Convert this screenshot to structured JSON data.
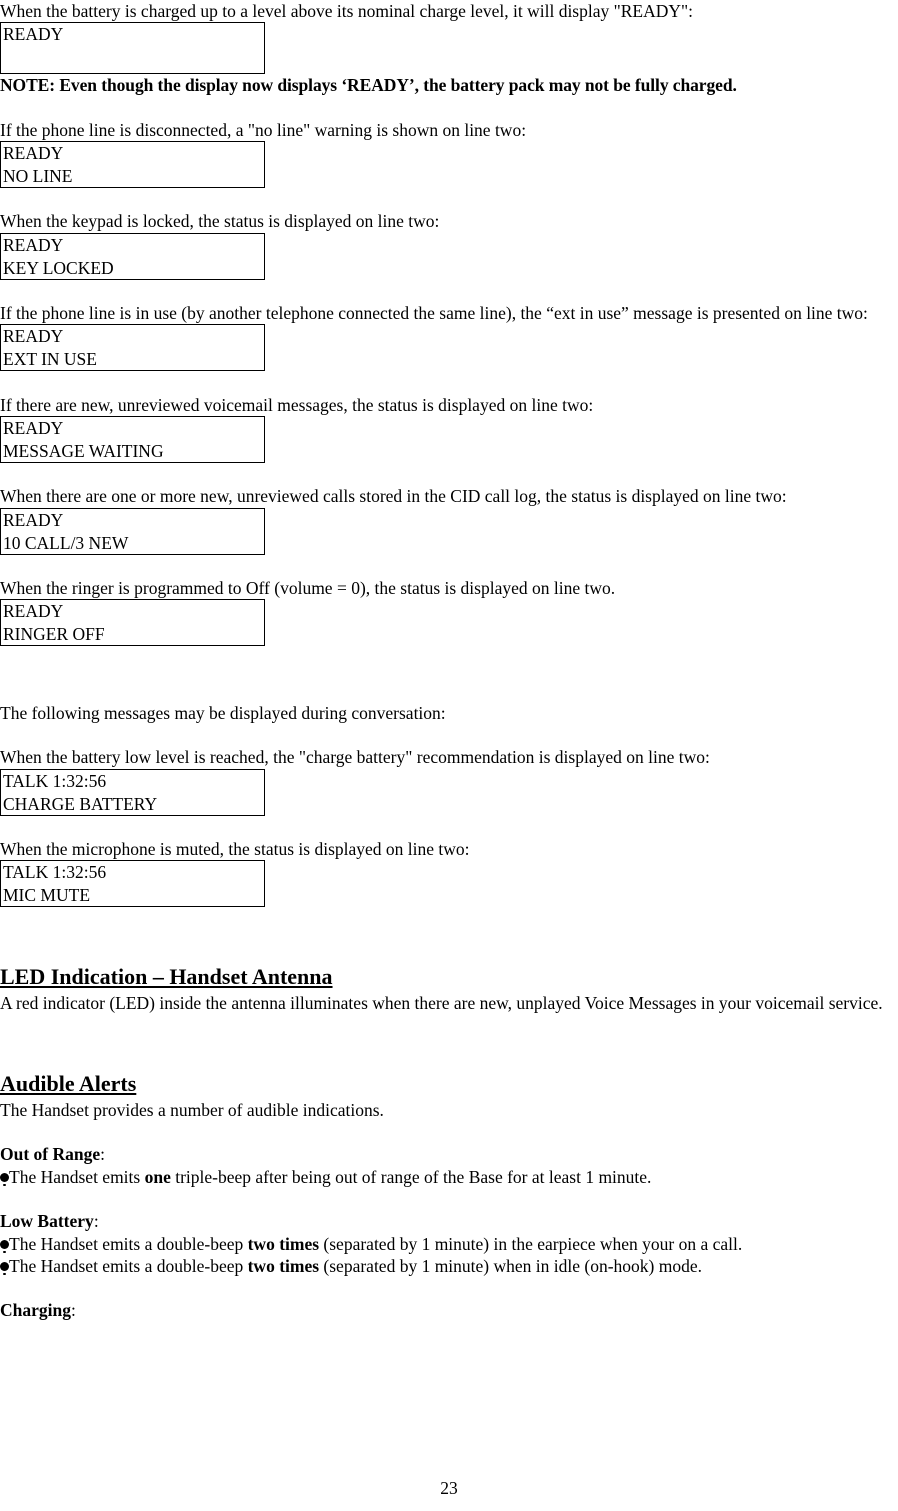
{
  "document": {
    "page_number": "23",
    "intro_paragraph": "When the battery is charged up to a level above its nominal charge level, it will display \"READY\":",
    "note": "NOTE:  Even though the display now displays ‘READY’, the battery pack may not be fully charged.",
    "sections": [
      {
        "paragraph": "If the phone line is disconnected, a \"no line\" warning is shown on line two:",
        "display_line1": "READY",
        "display_line2": "NO LINE"
      },
      {
        "paragraph": "When the keypad is locked, the status is displayed on line two:",
        "display_line1": "READY",
        "display_line2": "KEY LOCKED"
      },
      {
        "paragraph": "If the phone line is in use (by another telephone connected the same line), the “ext in use” message is presented on line two:",
        "display_line1": "READY",
        "display_line2": "EXT IN USE"
      },
      {
        "paragraph": "If there are new, unreviewed voicemail messages, the status is displayed on line two:",
        "display_line1": "READY",
        "display_line2": "MESSAGE WAITING"
      },
      {
        "paragraph": "When there are one or more new, unreviewed calls stored in the CID call log, the status is displayed on line two:",
        "display_line1": "READY",
        "display_line2": "10 CALL/3 NEW"
      },
      {
        "paragraph": "When the ringer is programmed to Off (volume = 0), the status is displayed on line two.",
        "display_line1": "READY",
        "display_line2": "RINGER OFF"
      }
    ],
    "first_display": {
      "line1": "READY",
      "line2": ""
    },
    "conversation_intro": "The following messages may be displayed during conversation:",
    "conversation_sections": [
      {
        "paragraph": "When the battery low level is reached, the \"charge battery\" recommendation is displayed on line two:",
        "display_line1": "TALK 1:32:56",
        "display_line2": "CHARGE BATTERY"
      },
      {
        "paragraph": "When the microphone is muted, the status is displayed on line two:",
        "display_line1": "TALK 1:32:56",
        "display_line2": "MIC MUTE"
      }
    ],
    "led_section": {
      "heading": "LED Indication – Handset Antenna",
      "body": "A red indicator (LED) inside the antenna illuminates when there are new, unplayed Voice Messages in your voicemail service."
    },
    "audible_section": {
      "heading": "Audible Alerts",
      "body": "The Handset provides a number of audible indications.",
      "groups": [
        {
          "label": "Out of Range",
          "colon": ":",
          "bullets": [
            {
              "pre": "The Handset emits ",
              "bold": "one",
              "post": " triple-beep after being out of range of the Base for at least 1 minute."
            }
          ]
        },
        {
          "label": "Low Battery",
          "colon": ":",
          "bullets": [
            {
              "pre": "The Handset emits a double-beep ",
              "bold": "two times",
              "post": " (separated by 1 minute) in the earpiece when your on a call."
            },
            {
              "pre": "The Handset emits a double-beep ",
              "bold": "two times",
              "post": " (separated by 1 minute) when in idle (on-hook) mode."
            }
          ]
        },
        {
          "label": "Charging",
          "colon": ":",
          "bullets": []
        }
      ]
    }
  }
}
